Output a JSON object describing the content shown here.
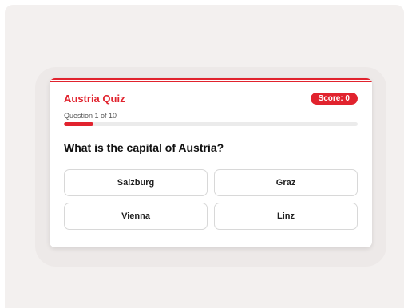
{
  "quiz": {
    "title": "Austria Quiz",
    "score_label": "Score: 0",
    "question_counter": "Question 1 of 10",
    "progress_percent": 10,
    "question": "What is the capital of Austria?",
    "answers": [
      "Salzburg",
      "Graz",
      "Vienna",
      "Linz"
    ]
  },
  "colors": {
    "accent": "#e1232e",
    "background": "#f3f0ef",
    "card": "#ffffff"
  }
}
